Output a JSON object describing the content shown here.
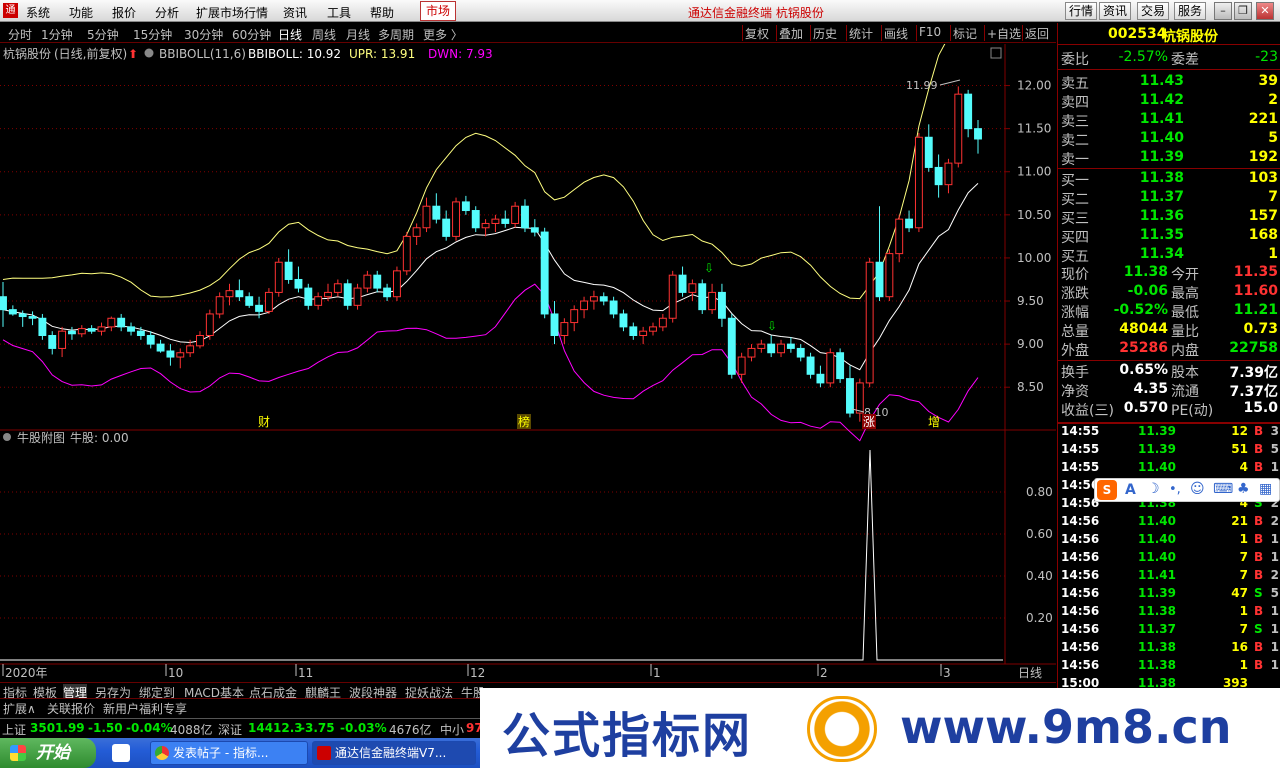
{
  "menu": [
    "系统",
    "功能",
    "报价",
    "分析",
    "扩展市场行情",
    "资讯",
    "工具",
    "帮助"
  ],
  "market_label": "市场",
  "title_center": "通达信金融终端 杭锅股份",
  "right_buttons": [
    "行情",
    "资讯",
    "交易",
    "服务"
  ],
  "periods": [
    "分时",
    "1分钟",
    "5分钟",
    "15分钟",
    "30分钟",
    "60分钟",
    "日线",
    "周线",
    "月线",
    "多周期",
    "更多 〉"
  ],
  "active_period": "日线",
  "tools": [
    "复权",
    "叠加",
    "历史",
    "统计",
    "画线",
    "F10",
    "标记",
    "+自选",
    "返回"
  ],
  "main_header": {
    "stock": "杭锅股份",
    "mode": "(日线,前复权)",
    "indicator": "BBIBOLL(11,6)",
    "bbi": "BBIBOLL: 10.92",
    "upr": "UPR: 13.91",
    "dwn": "DWN: 7.93"
  },
  "sub_header": {
    "name": "牛股附图",
    "value": "牛股: 0.00"
  },
  "price_axis": [
    "12.00",
    "11.50",
    "11.00",
    "10.50",
    "10.00",
    "9.50",
    "9.00",
    "8.50"
  ],
  "sub_axis": [
    "0.80",
    "0.60",
    "0.40",
    "0.20"
  ],
  "x_labels": [
    "2020年",
    "10",
    "11",
    "12",
    "1",
    "2",
    "3"
  ],
  "period_label": "日线",
  "annotations": {
    "high": "11.99",
    "low": "8.10",
    "markers": [
      "财",
      "榜",
      "涨",
      "增"
    ]
  },
  "colors": {
    "up": "#ff3232",
    "down": "#54fcfc",
    "upr": "#ffff80",
    "dwn": "#ff00ff",
    "bbi": "#ffffff",
    "grid": "#800000",
    "text": "#c0c0c0",
    "yellow": "#ffff00",
    "green": "#00e600"
  },
  "chart_data": {
    "type": "candlestick",
    "title": "",
    "xlabel": "",
    "ylabel": "",
    "ylim": [
      8.05,
      12.25
    ],
    "candles": [
      [
        9.55,
        9.72,
        9.2,
        9.4
      ],
      [
        9.4,
        9.45,
        9.33,
        9.35
      ],
      [
        9.35,
        9.39,
        9.2,
        9.32
      ],
      [
        9.32,
        9.38,
        9.22,
        9.3
      ],
      [
        9.3,
        9.35,
        9.05,
        9.1
      ],
      [
        9.1,
        9.15,
        8.88,
        8.95
      ],
      [
        8.95,
        9.2,
        8.85,
        9.15
      ],
      [
        9.15,
        9.2,
        9.05,
        9.12
      ],
      [
        9.12,
        9.22,
        9.08,
        9.18
      ],
      [
        9.18,
        9.22,
        9.12,
        9.15
      ],
      [
        9.15,
        9.25,
        9.1,
        9.2
      ],
      [
        9.2,
        9.32,
        9.15,
        9.3
      ],
      [
        9.3,
        9.35,
        9.15,
        9.2
      ],
      [
        9.2,
        9.25,
        9.1,
        9.15
      ],
      [
        9.15,
        9.2,
        9.05,
        9.1
      ],
      [
        9.1,
        9.15,
        8.95,
        9.0
      ],
      [
        9.0,
        9.05,
        8.9,
        8.92
      ],
      [
        8.92,
        9.0,
        8.75,
        8.85
      ],
      [
        8.85,
        8.95,
        8.72,
        8.9
      ],
      [
        8.9,
        9.05,
        8.85,
        8.98
      ],
      [
        8.98,
        9.15,
        8.95,
        9.1
      ],
      [
        9.1,
        9.4,
        9.05,
        9.35
      ],
      [
        9.35,
        9.6,
        9.3,
        9.55
      ],
      [
        9.55,
        9.7,
        9.45,
        9.62
      ],
      [
        9.62,
        9.75,
        9.5,
        9.55
      ],
      [
        9.55,
        9.6,
        9.42,
        9.45
      ],
      [
        9.45,
        9.55,
        9.3,
        9.38
      ],
      [
        9.38,
        9.65,
        9.35,
        9.6
      ],
      [
        9.6,
        10.0,
        9.55,
        9.95
      ],
      [
        9.95,
        10.1,
        9.7,
        9.75
      ],
      [
        9.75,
        9.9,
        9.6,
        9.65
      ],
      [
        9.65,
        9.7,
        9.4,
        9.45
      ],
      [
        9.45,
        9.6,
        9.4,
        9.55
      ],
      [
        9.55,
        9.7,
        9.5,
        9.6
      ],
      [
        9.6,
        9.75,
        9.55,
        9.7
      ],
      [
        9.7,
        9.75,
        9.4,
        9.45
      ],
      [
        9.45,
        9.7,
        9.4,
        9.65
      ],
      [
        9.65,
        9.85,
        9.6,
        9.8
      ],
      [
        9.8,
        9.85,
        9.6,
        9.65
      ],
      [
        9.65,
        9.7,
        9.5,
        9.55
      ],
      [
        9.55,
        9.9,
        9.5,
        9.85
      ],
      [
        9.85,
        10.3,
        9.8,
        10.25
      ],
      [
        10.25,
        10.4,
        10.15,
        10.35
      ],
      [
        10.35,
        10.7,
        10.3,
        10.6
      ],
      [
        10.6,
        10.75,
        10.4,
        10.45
      ],
      [
        10.45,
        10.55,
        10.2,
        10.25
      ],
      [
        10.25,
        10.7,
        10.2,
        10.65
      ],
      [
        10.65,
        10.72,
        10.5,
        10.55
      ],
      [
        10.55,
        10.6,
        10.3,
        10.35
      ],
      [
        10.35,
        10.45,
        10.25,
        10.4
      ],
      [
        10.4,
        10.5,
        10.3,
        10.45
      ],
      [
        10.45,
        10.55,
        10.35,
        10.4
      ],
      [
        10.4,
        10.65,
        10.35,
        10.6
      ],
      [
        10.6,
        10.68,
        10.3,
        10.35
      ],
      [
        10.35,
        10.45,
        10.25,
        10.3
      ],
      [
        10.3,
        10.35,
        9.3,
        9.35
      ],
      [
        9.35,
        9.5,
        9.0,
        9.1
      ],
      [
        9.1,
        9.3,
        9.0,
        9.25
      ],
      [
        9.25,
        9.45,
        9.15,
        9.4
      ],
      [
        9.4,
        9.55,
        9.3,
        9.5
      ],
      [
        9.5,
        9.62,
        9.4,
        9.55
      ],
      [
        9.55,
        9.6,
        9.45,
        9.5
      ],
      [
        9.5,
        9.55,
        9.3,
        9.35
      ],
      [
        9.35,
        9.4,
        9.15,
        9.2
      ],
      [
        9.2,
        9.25,
        9.05,
        9.1
      ],
      [
        9.1,
        9.2,
        9.0,
        9.15
      ],
      [
        9.15,
        9.25,
        9.1,
        9.2
      ],
      [
        9.2,
        9.35,
        9.15,
        9.3
      ],
      [
        9.3,
        9.85,
        9.25,
        9.8
      ],
      [
        9.8,
        9.9,
        9.55,
        9.6
      ],
      [
        9.6,
        9.75,
        9.5,
        9.7
      ],
      [
        9.7,
        9.75,
        9.35,
        9.4
      ],
      [
        9.4,
        9.7,
        9.35,
        9.6
      ],
      [
        9.6,
        9.7,
        9.2,
        9.3
      ],
      [
        9.3,
        9.35,
        8.6,
        8.65
      ],
      [
        8.65,
        8.9,
        8.55,
        8.85
      ],
      [
        8.85,
        9.0,
        8.8,
        8.95
      ],
      [
        8.95,
        9.05,
        8.9,
        9.0
      ],
      [
        9.0,
        9.1,
        8.85,
        8.9
      ],
      [
        8.9,
        9.05,
        8.85,
        9.0
      ],
      [
        9.0,
        9.08,
        8.9,
        8.95
      ],
      [
        8.95,
        9.0,
        8.8,
        8.85
      ],
      [
        8.85,
        8.9,
        8.6,
        8.65
      ],
      [
        8.65,
        8.75,
        8.5,
        8.55
      ],
      [
        8.55,
        8.95,
        8.5,
        8.9
      ],
      [
        8.9,
        8.95,
        8.55,
        8.6
      ],
      [
        8.6,
        8.75,
        8.15,
        8.2
      ],
      [
        8.2,
        8.6,
        8.1,
        8.55
      ],
      [
        8.55,
        10.0,
        8.5,
        9.95
      ],
      [
        9.95,
        10.6,
        9.5,
        9.55
      ],
      [
        9.55,
        10.1,
        9.5,
        10.05
      ],
      [
        10.05,
        10.5,
        9.95,
        10.45
      ],
      [
        10.45,
        10.55,
        10.3,
        10.35
      ],
      [
        10.35,
        11.45,
        10.3,
        11.4
      ],
      [
        11.4,
        11.55,
        11.0,
        11.05
      ],
      [
        11.05,
        11.2,
        10.7,
        10.85
      ],
      [
        10.85,
        11.15,
        10.75,
        11.1
      ],
      [
        11.1,
        11.99,
        11.05,
        11.9
      ],
      [
        11.9,
        11.95,
        11.4,
        11.5
      ],
      [
        11.5,
        11.6,
        11.21,
        11.38
      ]
    ]
  },
  "quote": {
    "code": "002534",
    "name": "杭锅股份",
    "wb_label": "委比",
    "wb": "-2.57%",
    "wc_label": "委差",
    "wc": "-23",
    "asks": [
      [
        "卖五",
        "11.43",
        "39"
      ],
      [
        "卖四",
        "11.42",
        "2"
      ],
      [
        "卖三",
        "11.41",
        "221"
      ],
      [
        "卖二",
        "11.40",
        "5"
      ],
      [
        "卖一",
        "11.39",
        "192"
      ]
    ],
    "bids": [
      [
        "买一",
        "11.38",
        "103"
      ],
      [
        "买二",
        "11.37",
        "7"
      ],
      [
        "买三",
        "11.36",
        "157"
      ],
      [
        "买四",
        "11.35",
        "168"
      ],
      [
        "买五",
        "11.34",
        "1"
      ]
    ],
    "stats": [
      [
        "现价",
        "11.38",
        "今开",
        "11.35"
      ],
      [
        "涨跌",
        "-0.06",
        "最高",
        "11.60"
      ],
      [
        "涨幅",
        "-0.52%",
        "最低",
        "11.21"
      ],
      [
        "总量",
        "48044",
        "量比",
        "0.73"
      ],
      [
        "外盘",
        "25286",
        "内盘",
        "22758"
      ],
      [
        "换手",
        "0.65%",
        "股本",
        "7.39亿"
      ],
      [
        "净资",
        "4.35",
        "流通",
        "7.37亿"
      ],
      [
        "收益(三)",
        "0.570",
        "PE(动)",
        "15.0"
      ]
    ]
  },
  "ticks": [
    [
      "14:55",
      "11.39",
      "12",
      "B",
      "3"
    ],
    [
      "14:55",
      "11.39",
      "51",
      "B",
      "5"
    ],
    [
      "14:55",
      "11.40",
      "4",
      "B",
      "1"
    ],
    [
      "14:56",
      "",
      "",
      "",
      ""
    ],
    [
      "14:56",
      "11.38",
      "4",
      "S",
      "2"
    ],
    [
      "14:56",
      "11.40",
      "21",
      "B",
      "2"
    ],
    [
      "14:56",
      "11.40",
      "1",
      "B",
      "1"
    ],
    [
      "14:56",
      "11.40",
      "7",
      "B",
      "1"
    ],
    [
      "14:56",
      "11.41",
      "7",
      "B",
      "2"
    ],
    [
      "14:56",
      "11.39",
      "47",
      "S",
      "5"
    ],
    [
      "14:56",
      "11.38",
      "1",
      "B",
      "1"
    ],
    [
      "14:56",
      "11.37",
      "7",
      "S",
      "1"
    ],
    [
      "14:56",
      "11.38",
      "16",
      "B",
      "1"
    ],
    [
      "14:56",
      "11.38",
      "1",
      "B",
      "1"
    ],
    [
      "15:00",
      "11.38",
      "393",
      "",
      ""
    ]
  ],
  "bottom_tabs": [
    "指标",
    "模板",
    "管理",
    "另存为",
    "绑定到",
    "MACD基本",
    "点石成金",
    "麒麟王",
    "波段神器",
    "捉妖战法",
    "牛股"
  ],
  "ext_tabs": [
    "扩展∧",
    "关联报价",
    "新用户福利专享"
  ],
  "status": [
    {
      "name": "上证",
      "v": "3501.99",
      "c": "-1.50",
      "p": "-0.04%",
      "a": "4088亿"
    },
    {
      "name": "深证",
      "v": "14412.3",
      "c": "-3.75",
      "p": "-0.03%",
      "a": "4676亿"
    },
    {
      "name": "中小",
      "v": "97",
      "c": "",
      "p": "",
      "a": ""
    }
  ],
  "taskbar": {
    "start": "开始",
    "tasks": [
      "发表帖子 - 指标...",
      "通达信金融终端V7..."
    ]
  },
  "watermark": {
    "left": "公式指标网",
    "right": "www.9m8.cn"
  },
  "ime": {
    "logo": "S"
  }
}
